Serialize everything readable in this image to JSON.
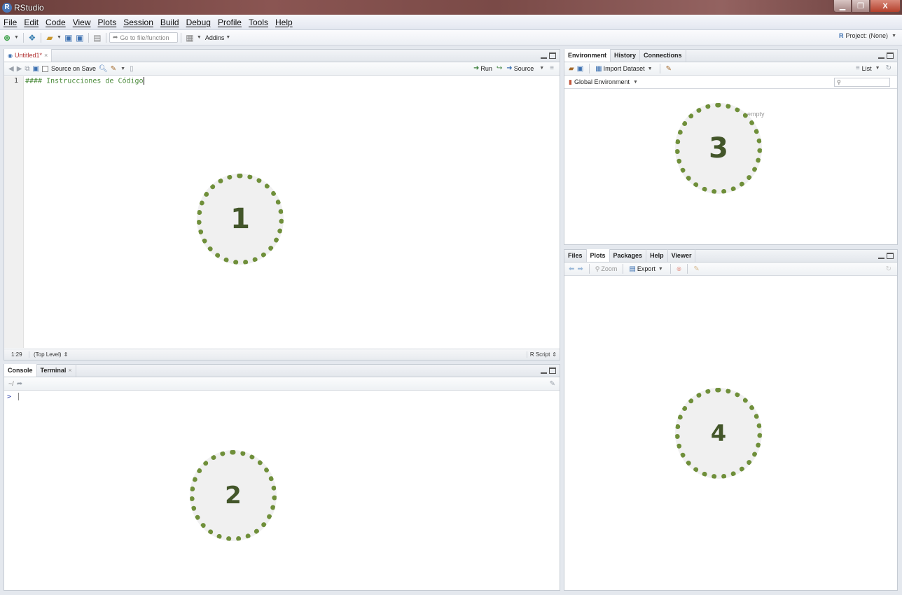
{
  "window": {
    "title": "RStudio",
    "logo_letter": "R",
    "min": "▁",
    "max": "❐",
    "close": "X"
  },
  "menu": [
    "File",
    "Edit",
    "Code",
    "View",
    "Plots",
    "Session",
    "Build",
    "Debug",
    "Profile",
    "Tools",
    "Help"
  ],
  "toolbar": {
    "goto_placeholder": "Go to file/function",
    "addins_label": "Addins",
    "project_label": "Project: (None)"
  },
  "editor": {
    "tab_label": "Untitled1*",
    "source_on_save": "Source on Save",
    "run_label": "Run",
    "source_label": "Source",
    "line_number": "1",
    "code_line": "#### Instrucciones de Código",
    "cursor_pos": "1:29",
    "scope": "(Top Level)",
    "file_type": "R Script"
  },
  "console": {
    "tabs": [
      "Console",
      "Terminal"
    ],
    "path": "~/",
    "prompt": ">"
  },
  "environment": {
    "tabs": [
      "Environment",
      "History",
      "Connections"
    ],
    "import_label": "Import Dataset",
    "list_label": "List",
    "scope_label": "Global Environment",
    "empty_text": "empty"
  },
  "files": {
    "tabs": [
      "Files",
      "Plots",
      "Packages",
      "Help",
      "Viewer"
    ],
    "zoom_label": "Zoom",
    "export_label": "Export"
  },
  "markers": [
    "1",
    "2",
    "3",
    "4"
  ],
  "colors": {
    "marker_border": "#6f8f3a",
    "marker_text": "#43562a",
    "code_comment": "#4a8a3a"
  }
}
